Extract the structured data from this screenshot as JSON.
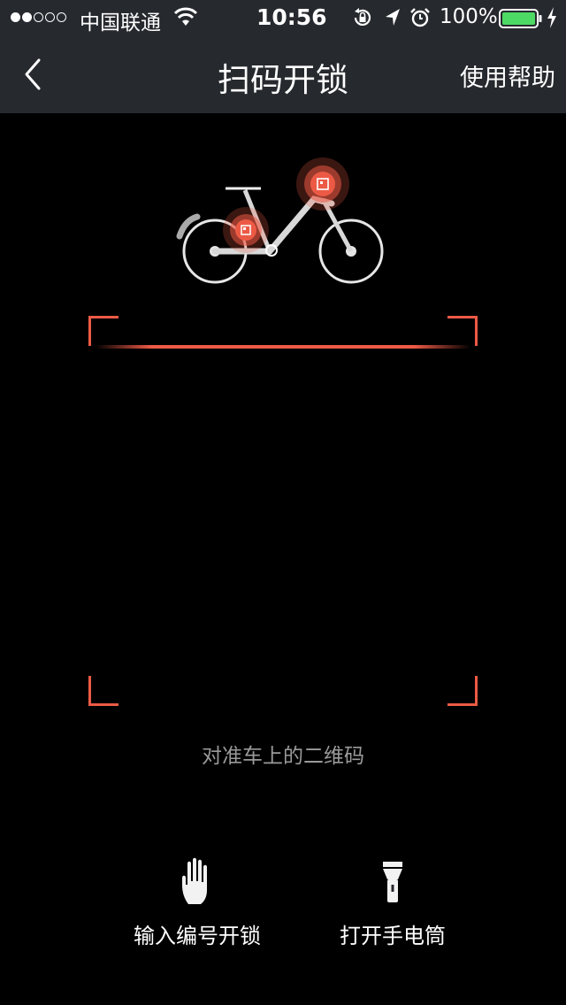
{
  "status_bar": {
    "carrier": "中国联通",
    "time": "10:56",
    "battery": "100%"
  },
  "nav": {
    "title": "扫码开锁",
    "help": "使用帮助"
  },
  "scanner": {
    "hint": "对准车上的二维码"
  },
  "actions": {
    "manual_unlock": "输入编号开锁",
    "flashlight": "打开手电筒"
  },
  "colors": {
    "accent": "#ec5a45",
    "header_bg": "#26292e"
  }
}
